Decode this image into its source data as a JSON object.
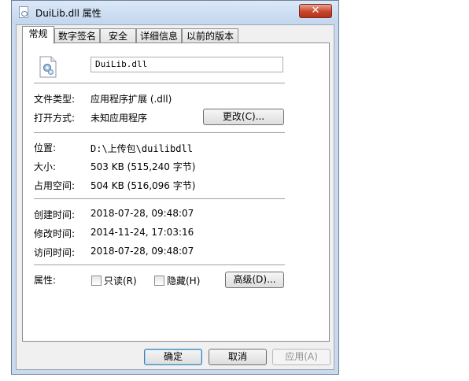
{
  "window": {
    "title": "DuiLib.dll 属性",
    "close_glyph": "✕"
  },
  "tabs": [
    {
      "label": "常规",
      "active": true
    },
    {
      "label": "数字签名",
      "active": false
    },
    {
      "label": "安全",
      "active": false
    },
    {
      "label": "详细信息",
      "active": false
    },
    {
      "label": "以前的版本",
      "active": false
    }
  ],
  "general": {
    "file_name": "DuiLib.dll",
    "file_icon": "dll-gear-icon",
    "file_type_label": "文件类型:",
    "file_type_value": "应用程序扩展 (.dll)",
    "opens_with_label": "打开方式:",
    "opens_with_value": "未知应用程序",
    "change_button": "更改(C)...",
    "location_label": "位置:",
    "location_value": "D:\\上传包\\duilibdll",
    "size_label": "大小:",
    "size_value": "503 KB (515,240 字节)",
    "size_on_disk_label": "占用空间:",
    "size_on_disk_value": "504 KB (516,096 字节)",
    "created_label": "创建时间:",
    "created_value": "2018-07-28, 09:48:07",
    "modified_label": "修改时间:",
    "modified_value": "2014-11-24, 17:03:16",
    "accessed_label": "访问时间:",
    "accessed_value": "2018-07-28, 09:48:07",
    "attributes_label": "属性:",
    "readonly_label": "只读(R)",
    "readonly_checked": false,
    "hidden_label": "隐藏(H)",
    "hidden_checked": false,
    "advanced_button": "高级(D)..."
  },
  "footer": {
    "ok_button": "确定",
    "cancel_button": "取消",
    "apply_button": "应用(A)"
  }
}
